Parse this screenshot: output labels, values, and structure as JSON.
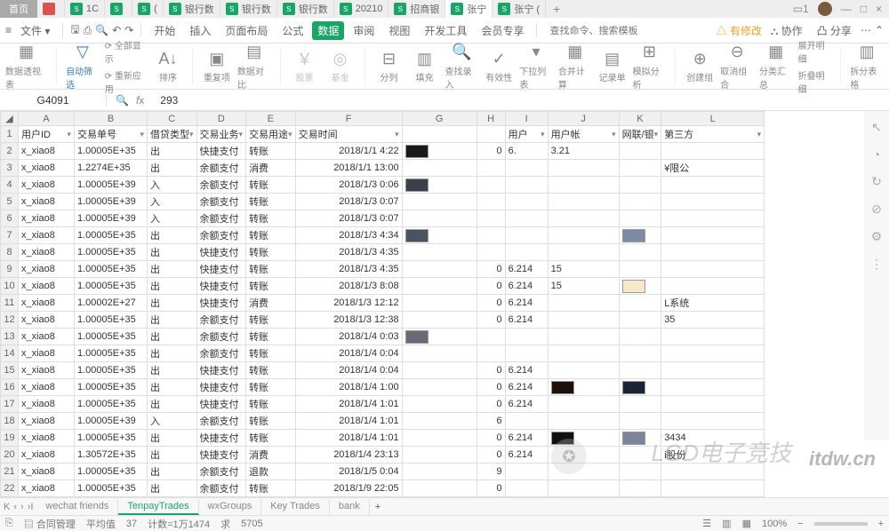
{
  "topbar": {
    "home": "首页",
    "tabs": [
      {
        "icon": "red",
        "label": ""
      },
      {
        "icon": "s",
        "label": "1C"
      },
      {
        "icon": "s",
        "label": ""
      },
      {
        "icon": "s",
        "label": "("
      },
      {
        "icon": "s",
        "label": "银行数"
      },
      {
        "icon": "s",
        "label": "银行数"
      },
      {
        "icon": "s",
        "label": "银行数"
      },
      {
        "icon": "s",
        "label": "20210"
      },
      {
        "icon": "s",
        "label": "招商银"
      },
      {
        "icon": "s",
        "label": "张宁",
        "active": true
      },
      {
        "icon": "s",
        "label": "张宁 ("
      }
    ],
    "counter": "1"
  },
  "menu": {
    "file": "文件",
    "start": "开始",
    "insert": "插入",
    "layout": "页面布局",
    "formula": "公式",
    "data": "数据",
    "review": "审阅",
    "view": "视图",
    "dev": "开发工具",
    "vip": "会员专享",
    "search_ph": "查找命令、搜索模板",
    "changes": "有修改",
    "coop": "协作",
    "share": "分享"
  },
  "ribbon": {
    "pivot": "数据透视表",
    "autofilter": "自动筛选",
    "showall": "全部显示",
    "reapply": "重新应用",
    "sort": "排序",
    "dedup": "重复项",
    "validate": "数据对比",
    "stock": "股票",
    "fund": "基金",
    "split": "分列",
    "fill": "填充",
    "findrec": "查找录入",
    "validity": "有效性",
    "dropdown": "下拉列表",
    "consolidate": "合并计算",
    "record": "记录单",
    "simulate": "模拟分析",
    "creategrp": "创建组",
    "ungroup": "取消组合",
    "subtotal": "分类汇总",
    "expand": "展开明细",
    "collapse": "折叠明细",
    "splittab": "拆分表格"
  },
  "formula": {
    "name": "G4091",
    "value": "293"
  },
  "cols": [
    "A",
    "B",
    "C",
    "D",
    "E",
    "F",
    "G",
    "H",
    "I",
    "J",
    "K",
    "L"
  ],
  "headers": {
    "A": "用户ID",
    "B": "交易单号",
    "C": "借贷类型",
    "D": "交易业务",
    "E": "交易用途",
    "F": "交易时间",
    "I": "用户",
    "J": "用户帐",
    "K": "网联/银",
    "L": "第三方"
  },
  "rows": [
    {
      "n": 2,
      "A": "x_xiao8",
      "B": "1.00005E+35",
      "C": "出",
      "D": "快捷支付",
      "E": "转账",
      "F": "2018/1/1 4:22",
      "G": "#191919",
      "H": "0",
      "I": "6.",
      "J": "3.21"
    },
    {
      "n": 3,
      "A": "x_xiao8",
      "B": "1.2274E+35",
      "C": "出",
      "D": "余额支付",
      "E": "消费",
      "F": "2018/1/1 13:00",
      "L": "¥限公"
    },
    {
      "n": 4,
      "A": "x_xiao8",
      "B": "1.00005E+39",
      "C": "入",
      "D": "余额支付",
      "E": "转账",
      "F": "2018/1/3 0:06",
      "G": "#3d404b"
    },
    {
      "n": 5,
      "A": "x_xiao8",
      "B": "1.00005E+39",
      "C": "入",
      "D": "余额支付",
      "E": "转账",
      "F": "2018/1/3 0:07"
    },
    {
      "n": 6,
      "A": "x_xiao8",
      "B": "1.00005E+39",
      "C": "入",
      "D": "余额支付",
      "E": "转账",
      "F": "2018/1/3 0:07"
    },
    {
      "n": 7,
      "A": "x_xiao8",
      "B": "1.00005E+35",
      "C": "出",
      "D": "余额支付",
      "E": "转账",
      "F": "2018/1/3 4:34",
      "G": "#4b5261",
      "K": "#7d8aa3"
    },
    {
      "n": 8,
      "A": "x_xiao8",
      "B": "1.00005E+35",
      "C": "出",
      "D": "快捷支付",
      "E": "转账",
      "F": "2018/1/3 4:35"
    },
    {
      "n": 9,
      "A": "x_xiao8",
      "B": "1.00005E+35",
      "C": "出",
      "D": "快捷支付",
      "E": "转账",
      "F": "2018/1/3 4:35",
      "H": "0",
      "I": "6.214",
      "J": "15"
    },
    {
      "n": 10,
      "A": "x_xiao8",
      "B": "1.00005E+35",
      "C": "出",
      "D": "快捷支付",
      "E": "转账",
      "F": "2018/1/3 8:08",
      "H": "0",
      "I": "6.214",
      "J": "15",
      "K": "#f6e9c9"
    },
    {
      "n": 11,
      "A": "x_xiao8",
      "B": "1.00002E+27",
      "C": "出",
      "D": "快捷支付",
      "E": "消费",
      "F": "2018/1/3 12:12",
      "H": "0",
      "I": "6.214",
      "L": "L系统"
    },
    {
      "n": 12,
      "A": "x_xiao8",
      "B": "1.00005E+35",
      "C": "出",
      "D": "余额支付",
      "E": "转账",
      "F": "2018/1/3 12:38",
      "H": "0",
      "I": "6.214",
      "L": "35"
    },
    {
      "n": 13,
      "A": "x_xiao8",
      "B": "1.00005E+35",
      "C": "出",
      "D": "余额支付",
      "E": "转账",
      "F": "2018/1/4 0:03",
      "G": "#666b77"
    },
    {
      "n": 14,
      "A": "x_xiao8",
      "B": "1.00005E+35",
      "C": "出",
      "D": "余额支付",
      "E": "转账",
      "F": "2018/1/4 0:04"
    },
    {
      "n": 15,
      "A": "x_xiao8",
      "B": "1.00005E+35",
      "C": "出",
      "D": "快捷支付",
      "E": "转账",
      "F": "2018/1/4 0:04",
      "H": "0",
      "I": "6.214"
    },
    {
      "n": 16,
      "A": "x_xiao8",
      "B": "1.00005E+35",
      "C": "出",
      "D": "快捷支付",
      "E": "转账",
      "F": "2018/1/4 1:00",
      "H": "0",
      "I": "6.214",
      "J2": "#1e110c",
      "K": "#1b2336"
    },
    {
      "n": 17,
      "A": "x_xiao8",
      "B": "1.00005E+35",
      "C": "出",
      "D": "快捷支付",
      "E": "转账",
      "F": "2018/1/4 1:01",
      "H": "0",
      "I": "6.214"
    },
    {
      "n": 18,
      "A": "x_xiao8",
      "B": "1.00005E+39",
      "C": "入",
      "D": "余额支付",
      "E": "转账",
      "F": "2018/1/4 1:01",
      "H": "6"
    },
    {
      "n": 19,
      "A": "x_xiao8",
      "B": "1.00005E+35",
      "C": "出",
      "D": "快捷支付",
      "E": "转账",
      "F": "2018/1/4 1:01",
      "H": "0",
      "I": "6.214",
      "J2": "#111111",
      "K": "#7b8498",
      "L": "3434"
    },
    {
      "n": 20,
      "A": "x_xiao8",
      "B": "1.30572E+35",
      "C": "出",
      "D": "快捷支付",
      "E": "消费",
      "F": "2018/1/4 23:13",
      "H": "0",
      "I": "6.214",
      "L": "i股份"
    },
    {
      "n": 21,
      "A": "x_xiao8",
      "B": "1.00005E+35",
      "C": "出",
      "D": "余额支付",
      "E": "退款",
      "F": "2018/1/5 0:04",
      "H": "9"
    },
    {
      "n": 22,
      "A": "x_xiao8",
      "B": "1.00005E+35",
      "C": "出",
      "D": "余额支付",
      "E": "转账",
      "F": "2018/1/9 22:05",
      "H": "0"
    }
  ],
  "sheets": [
    "wechat friends",
    "TenpayTrades",
    "wxGroups",
    "Key Trades",
    "bank"
  ],
  "status": {
    "contract": "合同管理",
    "avg": "平均值",
    "n37": "37",
    "count": "计数=1万1474",
    "sum": "求",
    "s5705": "5705",
    "zoom": "100%"
  },
  "watermark": "LGD电子竞技",
  "site": "itdw.cn"
}
